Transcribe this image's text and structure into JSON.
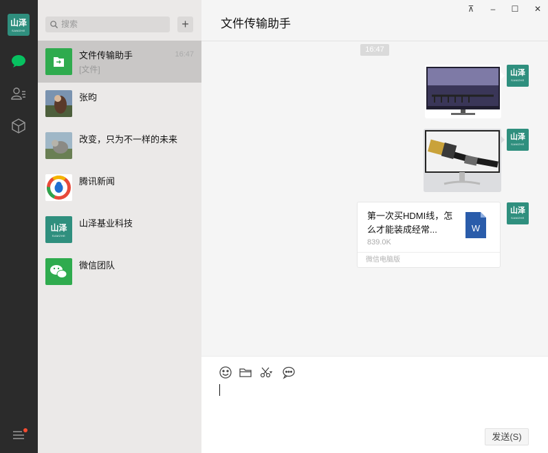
{
  "app": {
    "logo_text": "山泽",
    "logo_sub": "SAMZHE"
  },
  "nav": {
    "items": [
      "chat-icon",
      "contacts-icon",
      "favorites-icon"
    ],
    "menu": "menu-icon"
  },
  "search": {
    "placeholder": "搜索",
    "add_label": "+"
  },
  "chats": [
    {
      "name": "文件传输助手",
      "preview": "[文件]",
      "time": "16:47",
      "active": true
    },
    {
      "name": "张昀",
      "preview": "",
      "time": ""
    },
    {
      "name": "改变，只为不一样的未来",
      "preview": "",
      "time": ""
    },
    {
      "name": "腾讯新闻",
      "preview": "",
      "time": ""
    },
    {
      "name": "山泽基业科技",
      "preview": "",
      "time": ""
    },
    {
      "name": "微信团队",
      "preview": "",
      "time": ""
    }
  ],
  "window": {
    "pin": "⊼",
    "minimize": "–",
    "maximize": "☐",
    "close": "✕"
  },
  "conversation": {
    "title": "文件传输助手",
    "timestamp": "16:47",
    "file": {
      "name": "第一次买HDMI线，怎么才能装成经常...",
      "size": "839.0K",
      "source": "微信电脑版",
      "type": "W"
    }
  },
  "composer": {
    "send_label": "发送(S)"
  },
  "colors": {
    "accent": "#07c160",
    "nav_bg": "#2b2b2b",
    "list_bg": "#ebe9e8",
    "brand": "#2f8f7e"
  }
}
